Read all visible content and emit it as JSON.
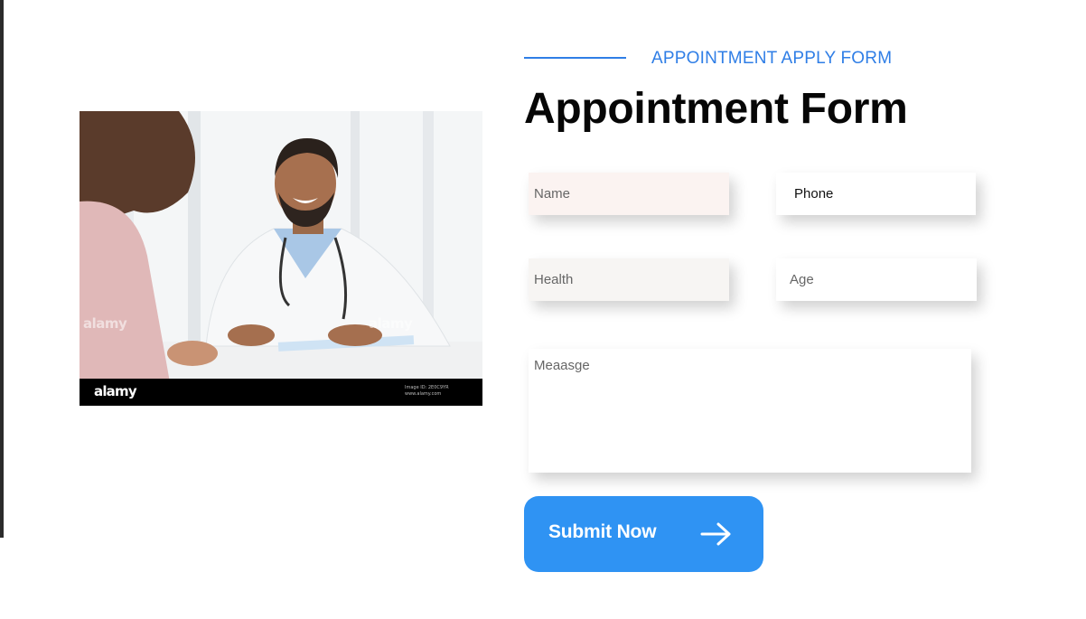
{
  "section": {
    "eyebrow": "APPOINTMENT APPLY FORM",
    "title": "Appointment Form"
  },
  "photo": {
    "alt": "Doctor consulting patient",
    "watermark": "alamy",
    "footer_logo": "alamy",
    "footer_credit_line1": "Image ID: 2E0C9YR",
    "footer_credit_line2": "www.alamy.com"
  },
  "form": {
    "name": {
      "placeholder": "Name",
      "value": ""
    },
    "phone": {
      "placeholder": "Phone",
      "value": ""
    },
    "health": {
      "placeholder": "Health",
      "value": ""
    },
    "age": {
      "placeholder": "Age",
      "value": ""
    },
    "message": {
      "placeholder": "Meaasge",
      "value": ""
    },
    "submit_label": "Submit Now",
    "submit_icon": "arrow-right-icon"
  },
  "colors": {
    "accent": "#2f7ee6",
    "button": "#2f93f3",
    "title": "#060606"
  }
}
